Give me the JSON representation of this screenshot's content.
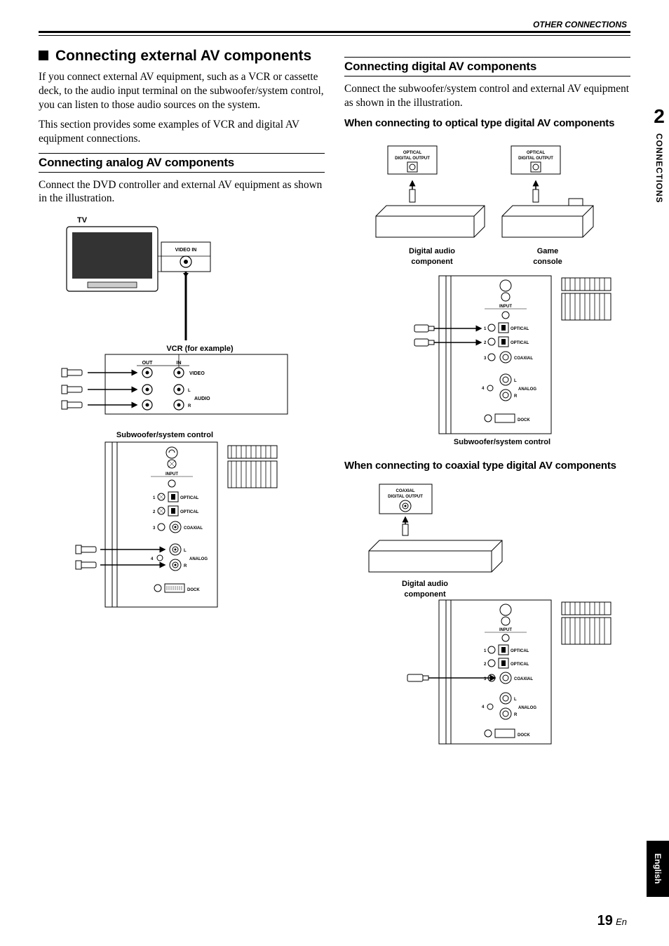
{
  "header": {
    "section": "OTHER CONNECTIONS"
  },
  "side": {
    "chapter": "2",
    "category": "CONNECTIONS"
  },
  "lang": "English",
  "page": {
    "num": "19",
    "suffix": "En"
  },
  "left": {
    "h1": "Connecting external AV components",
    "p1": "If you connect external AV equipment, such as a VCR or cassette deck, to the audio input terminal on the subwoofer/system control, you can listen to those audio sources on the system.",
    "p2": "This section provides some examples of VCR and digital AV equipment connections.",
    "h2": "Connecting analog AV components",
    "p3": "Connect the DVD controller and external AV equipment as shown in the illustration.",
    "d": {
      "tv": "TV",
      "videoin": "VIDEO IN",
      "vcr": "VCR (for example)",
      "out": "OUT",
      "in": "IN",
      "video": "VIDEO",
      "audio": "AUDIO",
      "l": "L",
      "r": "R",
      "sub": "Subwoofer/system control",
      "input": "INPUT",
      "opt": "OPTICAL",
      "coax": "COAXIAL",
      "anlg": "ANALOG",
      "dock": "DOCK"
    }
  },
  "right": {
    "h2": "Connecting digital AV components",
    "p1": "Connect the subwoofer/system control and external AV equipment as shown in the illustration.",
    "h3a": "When connecting to optical type digital AV components",
    "h3b": "When connecting to coaxial type digital AV components",
    "d": {
      "optout": "OPTICAL\nDIGITAL OUTPUT",
      "coaxout": "COAXIAL\nDIGITAL OUTPUT",
      "dac": "Digital audio component",
      "game": "Game console",
      "sub": "Subwoofer/system control",
      "input": "INPUT",
      "opt": "OPTICAL",
      "coax": "COAXIAL",
      "anlg": "ANALOG",
      "dock": "DOCK"
    }
  }
}
